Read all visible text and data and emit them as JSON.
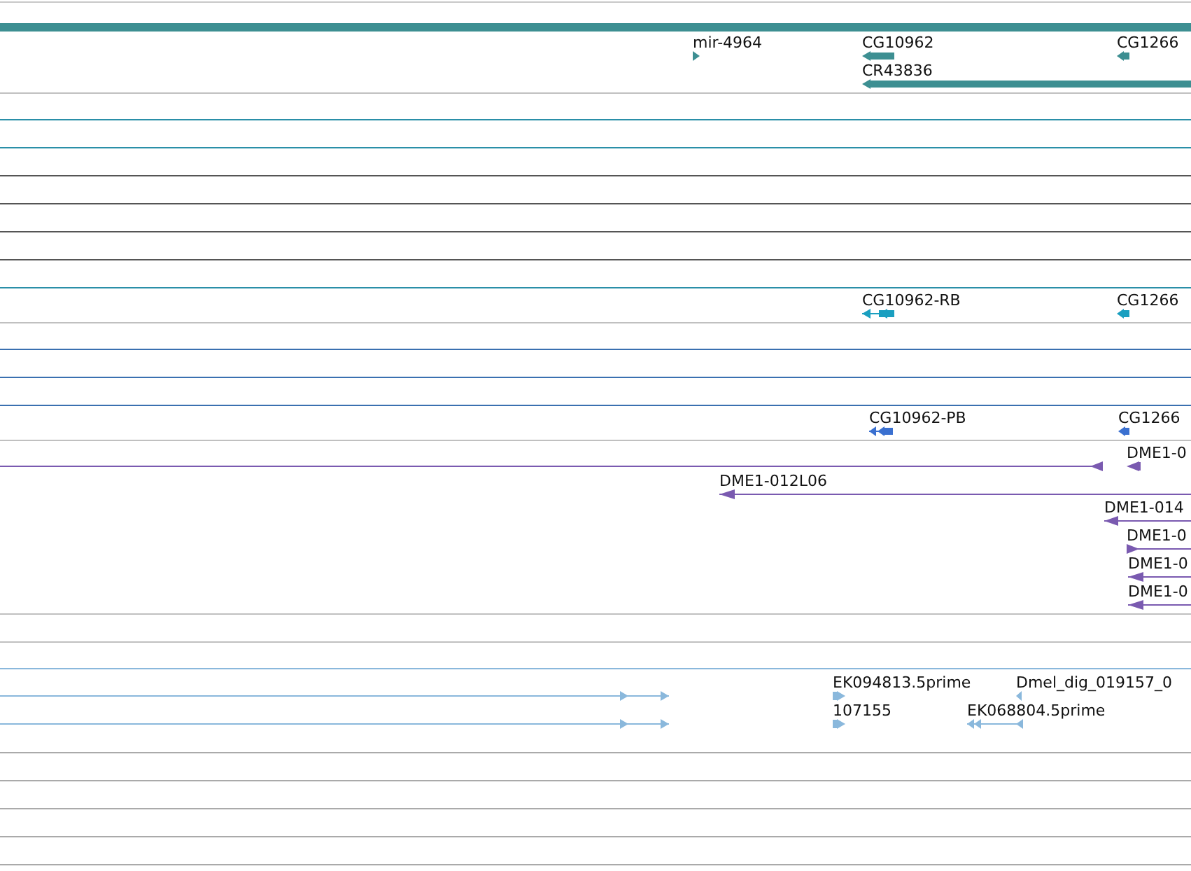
{
  "tracks": [
    {
      "color": "#3d8f92",
      "features": [
        {
          "kind": "band"
        },
        {
          "kind": "gene",
          "label": "mir-4964",
          "reverse": false
        },
        {
          "kind": "gene",
          "label": "CG10962",
          "reverse": true
        },
        {
          "kind": "gene",
          "label": "CG1266",
          "reverse": true
        },
        {
          "kind": "gene",
          "label": "CR43836",
          "reverse": true
        }
      ]
    },
    {
      "color": "#1a9fc0",
      "features": [
        {
          "label": "CG10962-RB",
          "reverse": true
        },
        {
          "label": "CG1266",
          "reverse": true
        }
      ]
    },
    {
      "color": "#3a70d0",
      "features": [
        {
          "label": "CG10962-PB",
          "reverse": true
        },
        {
          "label": "CG1266",
          "reverse": true
        }
      ]
    },
    {
      "color": "#7a5ab0",
      "features": [
        {
          "reverse": true
        },
        {
          "label": "DME1-0",
          "reverse": true
        },
        {
          "label": "DME1-012L06",
          "reverse": true
        },
        {
          "label": "DME1-014",
          "reverse": true
        },
        {
          "label": "DME1-0",
          "reverse": false
        },
        {
          "label": "DME1-0",
          "reverse": true
        },
        {
          "label": "DME1-0",
          "reverse": true
        }
      ]
    },
    {
      "color": "#8ab8dc",
      "features": [
        {
          "reverse": false
        },
        {
          "reverse": false
        },
        {
          "label": "EK094813.5prime",
          "reverse": false
        },
        {
          "label": "Dmel_dig_019157_0",
          "reverse": true
        },
        {
          "label": "107155",
          "reverse": false
        },
        {
          "label": "EK068804.5prime",
          "reverse": true
        }
      ]
    }
  ]
}
